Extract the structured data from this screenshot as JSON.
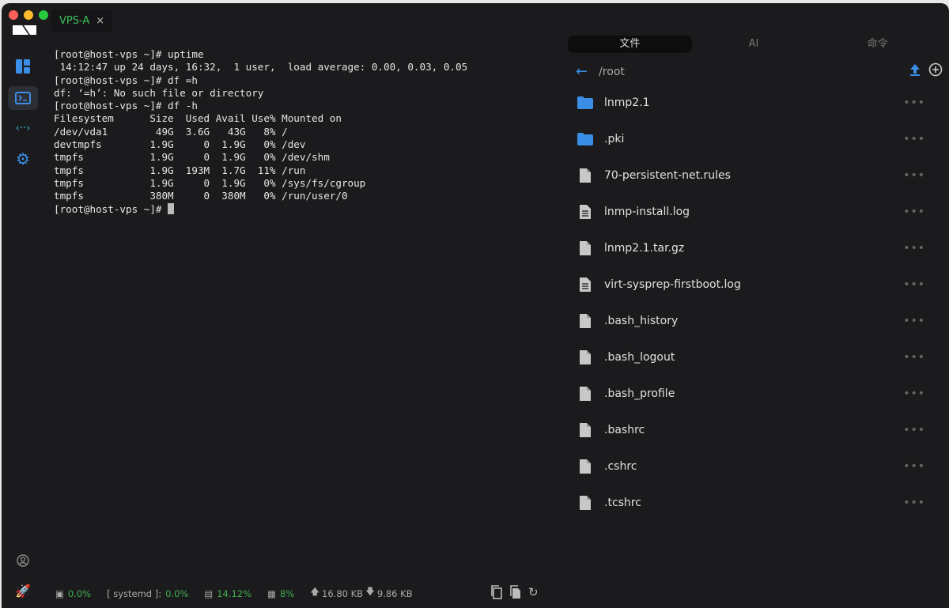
{
  "window": {
    "tab_title": "VPS-A",
    "tab_close": "×"
  },
  "terminal": {
    "lines": [
      "[root@host-vps ~]# uptime",
      " 14:12:47 up 24 days, 16:32,  1 user,  load average: 0.00, 0.03, 0.05",
      "[root@host-vps ~]# df =h",
      "df: ‘=h’: No such file or directory",
      "[root@host-vps ~]# df -h",
      "Filesystem      Size  Used Avail Use% Mounted on",
      "/dev/vda1        49G  3.6G   43G   8% /",
      "devtmpfs        1.9G     0  1.9G   0% /dev",
      "tmpfs           1.9G     0  1.9G   0% /dev/shm",
      "tmpfs           1.9G  193M  1.7G  11% /run",
      "tmpfs           1.9G     0  1.9G   0% /sys/fs/cgroup",
      "tmpfs           380M     0  380M   0% /run/user/0"
    ],
    "prompt": "[root@host-vps ~]# "
  },
  "panel": {
    "tabs": [
      "文件",
      "AI",
      "命令"
    ],
    "path": "/root",
    "more": "•••",
    "files": [
      {
        "name": "lnmp2.1",
        "type": "folder"
      },
      {
        "name": ".pki",
        "type": "folder"
      },
      {
        "name": "70-persistent-net.rules",
        "type": "file"
      },
      {
        "name": "lnmp-install.log",
        "type": "text"
      },
      {
        "name": "lnmp2.1.tar.gz",
        "type": "file"
      },
      {
        "name": "virt-sysprep-firstboot.log",
        "type": "text"
      },
      {
        "name": ".bash_history",
        "type": "file"
      },
      {
        "name": ".bash_logout",
        "type": "file"
      },
      {
        "name": ".bash_profile",
        "type": "file"
      },
      {
        "name": ".bashrc",
        "type": "file"
      },
      {
        "name": ".cshrc",
        "type": "file"
      },
      {
        "name": ".tcshrc",
        "type": "file"
      }
    ]
  },
  "status": {
    "cpu": "0.0%",
    "process_label": "[ systemd ]:",
    "process_value": "0.0%",
    "memory": "14.12%",
    "disk": "8%",
    "upload": "16.80 KB",
    "download": "9.86 KB"
  },
  "colors": {
    "accent": "#3a8ee6",
    "green": "#3fae4f"
  }
}
